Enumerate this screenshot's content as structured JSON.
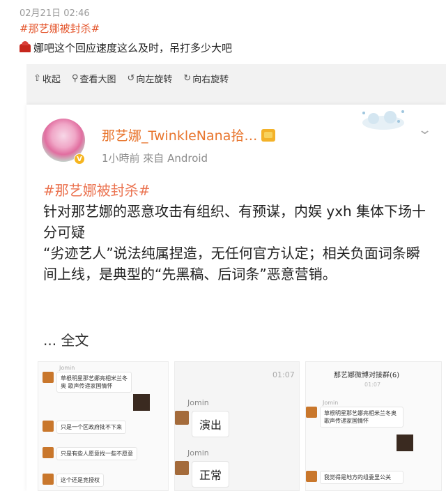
{
  "post": {
    "timestamp": "02月21日 02:46",
    "hashtag": "#那艺娜被封杀#",
    "text": "娜吧这个回应速度这么及时，吊打多少大吧"
  },
  "toolbar": {
    "collapse": "收起",
    "view_large": "查看大图",
    "rotate_left": "向左旋转",
    "rotate_right": "向右旋转"
  },
  "card": {
    "username": "那艺娜_TwinkleNana拾…",
    "meta": "1小時前  來自 Android",
    "hashtag": "#那艺娜被封杀#",
    "paragraph1": "针对那艺娜的恶意攻击有组织、有预谋，内娱 yxh 集体下场十分可疑",
    "paragraph2": "“劣迹艺人”说法纯属捏造，无任何官方认定；相关负面词条瞬间上线，是典型的“先黑稿、后词条”恶意营销。",
    "more_prefix": "... ",
    "more_link": "全文"
  },
  "thumbs": {
    "t1": {
      "name": "Jomin",
      "msg1": "草根明星那艺娜亮相米兰冬奥 歌声传递家国情怀",
      "msg2": "只是一个区政府批不下来",
      "msg3": "只是有些人愿意找一些不愿意",
      "msg4": "这个还是竞授权"
    },
    "t2": {
      "time": "01:07",
      "name1": "Jomin",
      "msg1": "演出",
      "name2": "Jomin",
      "msg2": "正常"
    },
    "t3": {
      "title": "那艺娜微博对接群(6)",
      "sub": "01:07",
      "name": "Jomin",
      "msg1": "草根明星那艺娜亮相米兰冬奥 歌声传递家国情怀",
      "msg2": "我觉得是地方的组委里公关"
    }
  }
}
